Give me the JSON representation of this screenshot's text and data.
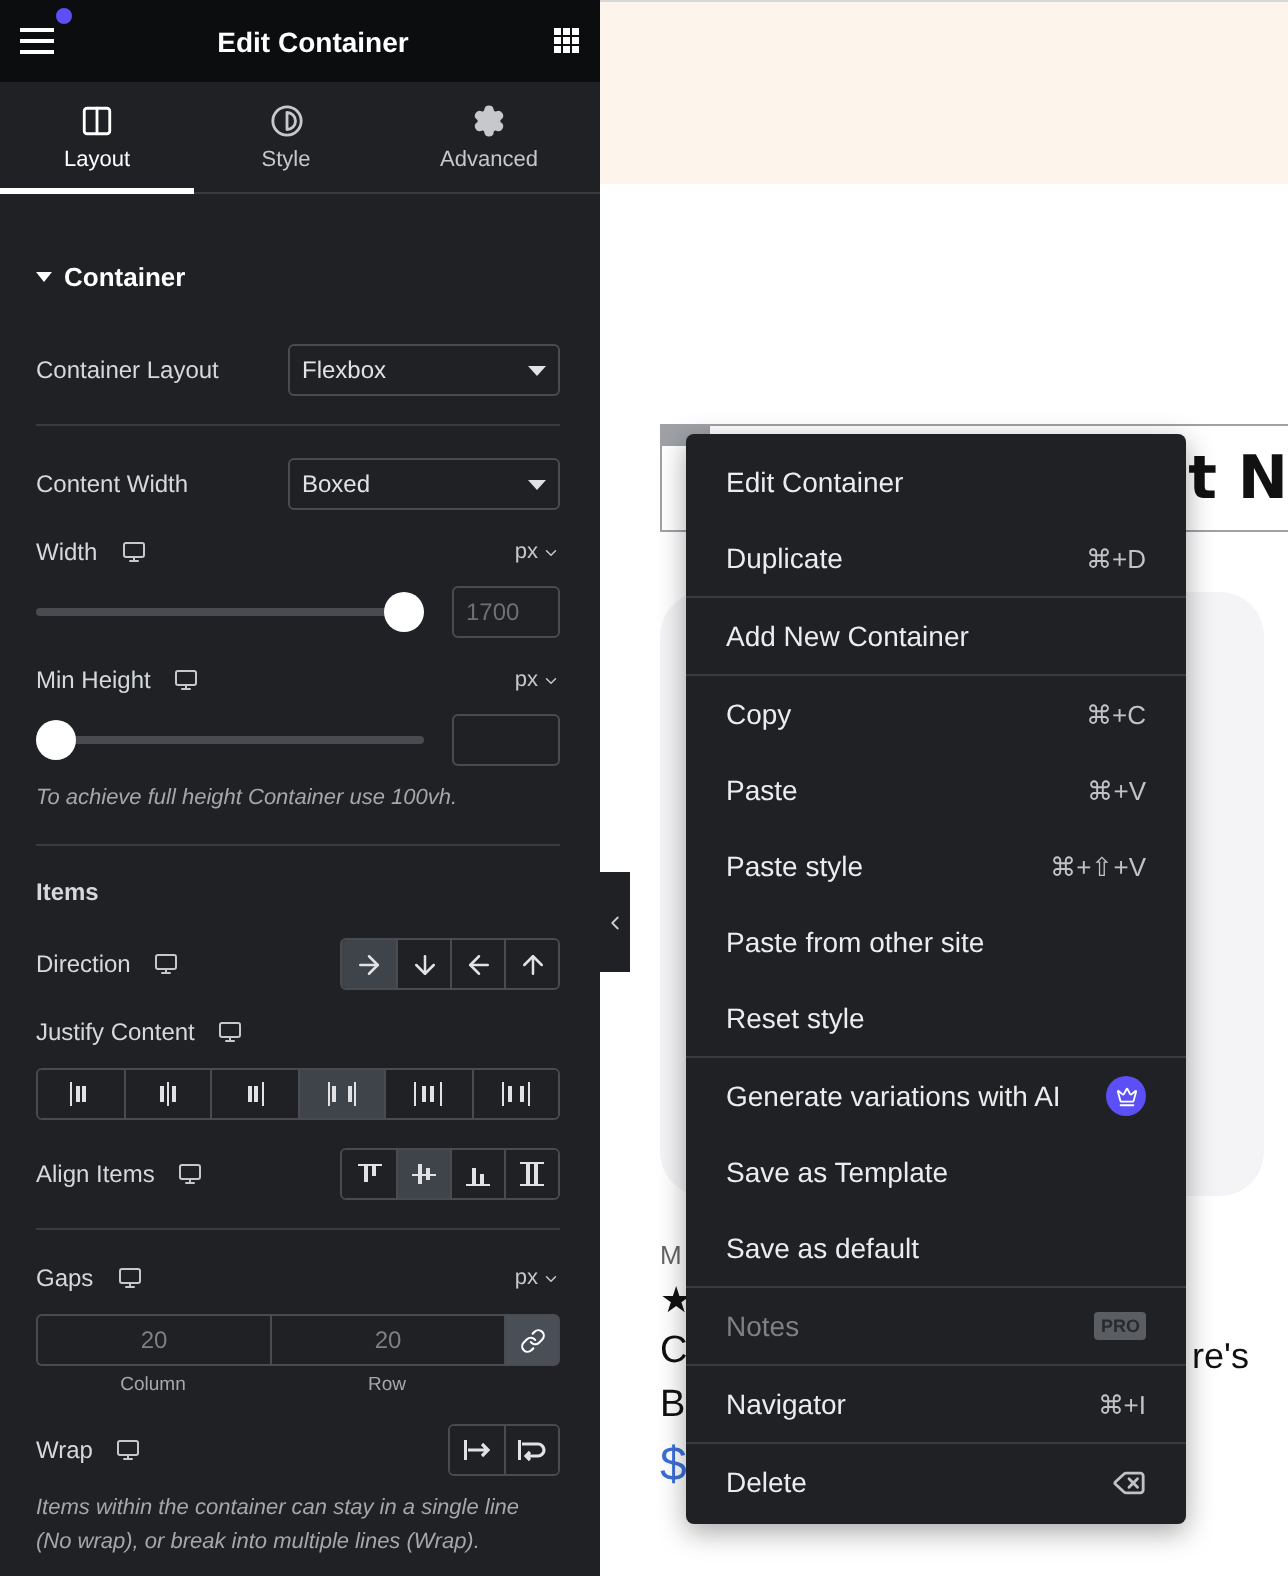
{
  "header": {
    "title": "Edit Container",
    "notification": true
  },
  "tabs": [
    {
      "label": "Layout",
      "selected": true
    },
    {
      "label": "Style",
      "selected": false
    },
    {
      "label": "Advanced",
      "selected": false
    }
  ],
  "section": {
    "title": "Container",
    "expanded": true
  },
  "control_groups": [
    [
      {
        "kind": "select",
        "label": "Container Layout",
        "value": "Flexbox"
      }
    ],
    [
      {
        "kind": "select",
        "label": "Content Width",
        "value": "Boxed"
      },
      {
        "kind": "slider",
        "label": "Width",
        "unit": "px",
        "level": 1,
        "placeholder": "1700"
      },
      {
        "kind": "slider",
        "label": "Min Height",
        "unit": "px",
        "level": 0
      },
      {
        "kind": "note",
        "text": "To achieve full height Container use 100vh."
      }
    ],
    [
      {
        "kind": "subheading",
        "label": "Items"
      },
      {
        "kind": "direction",
        "label": "Direction",
        "options": [
          {
            "selected": true
          },
          {
            "selected": false
          },
          {
            "selected": false
          },
          {
            "selected": false
          }
        ]
      },
      {
        "kind": "justify",
        "label": "Justify Content",
        "options": [
          {
            "selected": false
          },
          {
            "selected": false
          },
          {
            "selected": false
          },
          {
            "selected": true
          },
          {
            "selected": false
          },
          {
            "selected": false
          }
        ]
      },
      {
        "kind": "align",
        "label": "Align Items",
        "options": [
          {
            "selected": false
          },
          {
            "selected": true
          },
          {
            "selected": false
          },
          {
            "selected": false
          }
        ]
      }
    ],
    [
      {
        "kind": "gaps",
        "label": "Gaps",
        "unit": "px",
        "fields": [
          {
            "placeholder": "20",
            "caption": "Column"
          },
          {
            "placeholder": "20",
            "caption": "Row"
          }
        ],
        "linked": true
      },
      {
        "kind": "wrap",
        "label": "Wrap",
        "options": [
          {
            "selected": false
          },
          {
            "selected": false
          }
        ]
      },
      {
        "kind": "note",
        "text": "Items within the container can stay in a single line (No wrap), or break into multiple lines (Wrap)."
      }
    ]
  ],
  "preview": {
    "heading_right": "t N",
    "fragments_left": [
      "M",
      "★",
      "C",
      "B",
      "$"
    ],
    "fragment_right": "re's"
  },
  "context_menu": {
    "groups": [
      [
        {
          "kind": "plain",
          "label": "Edit Container",
          "disabled": false
        },
        {
          "kind": "shortcut",
          "label": "Duplicate",
          "shortcut": "⌘+D",
          "disabled": false
        }
      ],
      [
        {
          "kind": "plain",
          "label": "Add New Container",
          "disabled": false
        }
      ],
      [
        {
          "kind": "shortcut",
          "label": "Copy",
          "shortcut": "⌘+C",
          "disabled": false
        },
        {
          "kind": "shortcut",
          "label": "Paste",
          "shortcut": "⌘+V",
          "disabled": false
        },
        {
          "kind": "shortcut",
          "label": "Paste style",
          "shortcut": "⌘+⇧+V",
          "disabled": false
        },
        {
          "kind": "plain",
          "label": "Paste from other site",
          "disabled": false
        },
        {
          "kind": "plain",
          "label": "Reset style",
          "disabled": false
        }
      ],
      [
        {
          "kind": "ai",
          "label": "Generate variations with AI",
          "disabled": false
        },
        {
          "kind": "plain",
          "label": "Save as Template",
          "disabled": false
        },
        {
          "kind": "plain",
          "label": "Save as default",
          "disabled": false
        }
      ],
      [
        {
          "kind": "pro",
          "label": "Notes",
          "badge": "PRO",
          "disabled": true
        }
      ],
      [
        {
          "kind": "shortcut",
          "label": "Navigator",
          "shortcut": "⌘+I",
          "disabled": false
        }
      ],
      [
        {
          "kind": "delete",
          "label": "Delete",
          "disabled": false
        }
      ]
    ]
  }
}
